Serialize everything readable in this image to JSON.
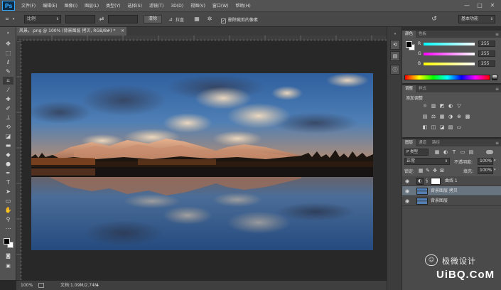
{
  "app": {
    "logo": "Ps"
  },
  "menu": [
    "文件(F)",
    "编辑(E)",
    "图像(I)",
    "图层(L)",
    "类型(Y)",
    "选择(S)",
    "滤镜(T)",
    "3D(D)",
    "视图(V)",
    "窗口(W)",
    "帮助(H)"
  ],
  "window_controls": [
    "—",
    "□",
    "✕"
  ],
  "options": {
    "ratio_select": "比例",
    "clear_button": "清除",
    "straighten_label": "拉直",
    "delete_cropped_label": "删除裁剪的像素",
    "workspace_select": "基本功能"
  },
  "document": {
    "tab_title": "风景。.png @ 100% (背景图层 拷贝, RGB/8#) *",
    "close_glyph": "×",
    "zoom": "100%",
    "doc_info": "文档:1.09M/2.74M"
  },
  "color_panel": {
    "tabs": [
      "颜色",
      "色板"
    ],
    "channels": [
      {
        "label": "R",
        "value": "255",
        "gradient": [
          "#00ffff",
          "#ffffff"
        ]
      },
      {
        "label": "G",
        "value": "255",
        "gradient": [
          "#ff00ff",
          "#ffffff"
        ]
      },
      {
        "label": "B",
        "value": "255",
        "gradient": [
          "#ffff00",
          "#ffffff"
        ]
      }
    ]
  },
  "adjust_panel": {
    "tabs": [
      "调整",
      "样式"
    ],
    "title": "添加调整",
    "icons_row1": [
      "☼",
      "▥",
      "◩",
      "◐",
      "▽"
    ],
    "icons_row2": [
      "▤",
      "⚖",
      "▦",
      "◑",
      "⊕",
      "▩"
    ],
    "icons_row3": [
      "◧",
      "◫",
      "◪",
      "▨",
      "▭"
    ]
  },
  "layers_panel": {
    "tabs": [
      "图层",
      "通道",
      "路径"
    ],
    "kind_select": "P 类型",
    "blend_mode": "正常",
    "opacity_label": "不透明度:",
    "opacity_value": "100%",
    "lock_label": "锁定:",
    "fill_label": "填充:",
    "fill_value": "100%",
    "layers": [
      {
        "name": "曲线 1",
        "selected": false
      },
      {
        "name": "背景图层 拷贝",
        "selected": true
      },
      {
        "name": "背景图层",
        "selected": false
      }
    ]
  },
  "watermark": {
    "text": "极微设计",
    "site": "UiBQ.CoM"
  },
  "colors": {
    "accent": "#31a8ff",
    "selected_layer": "#687480",
    "panel_bg": "#535353"
  }
}
